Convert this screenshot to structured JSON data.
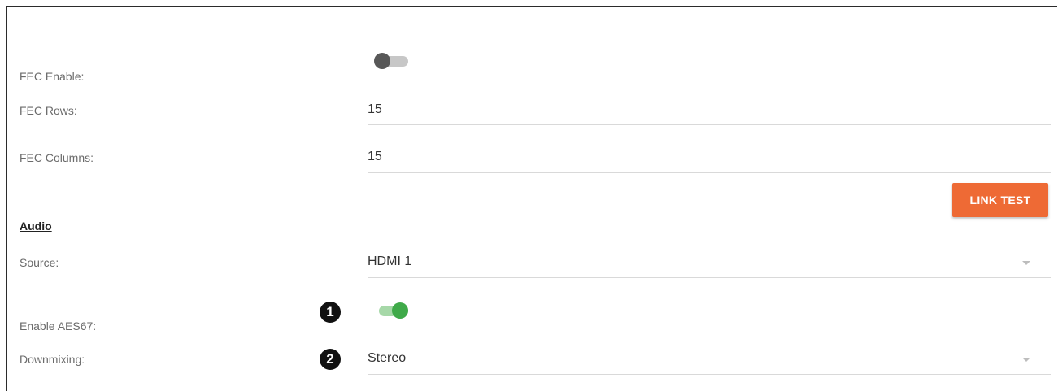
{
  "fec": {
    "enable_label": "FEC Enable:",
    "enable_state": false,
    "rows_label": "FEC Rows:",
    "rows_value": "15",
    "columns_label": "FEC Columns:",
    "columns_value": "15"
  },
  "link_test_label": "LINK TEST",
  "audio": {
    "section_title": "Audio",
    "source_label": "Source:",
    "source_value": "HDMI 1",
    "aes67_label": "Enable AES67:",
    "aes67_state": true,
    "downmix_label": "Downmixing:",
    "downmix_value": "Stereo"
  },
  "callouts": [
    "1",
    "2"
  ],
  "colors": {
    "accent": "#ee6a35",
    "toggle_on": "#3faa49",
    "toggle_off": "#585858"
  }
}
